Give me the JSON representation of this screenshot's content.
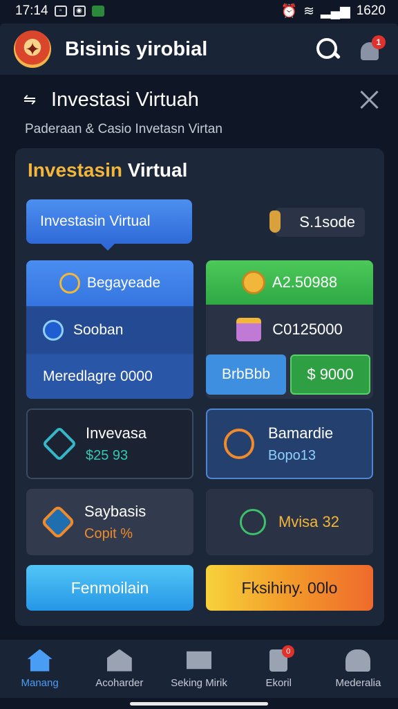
{
  "statusbar": {
    "time": "17:14",
    "right_text": "1620"
  },
  "appbar": {
    "title": "Bisinis yirobial",
    "notification_count": "1"
  },
  "section": {
    "title": "Investasi Virtuah",
    "subtitle": "Paderaan & Casio Invetasn Virtan"
  },
  "card": {
    "title_gold": "Investasin",
    "title_white": " Virtual",
    "tooltip": "Investasin Virtual",
    "balance": "S.1sode",
    "left_panel": {
      "row1": "Begayeade",
      "row2": "Sooban",
      "row3": "Meredlagre 0000"
    },
    "right_panel": {
      "row1": "A2.50988",
      "row2": "C0125000",
      "btn1": "BrbBbb",
      "btn2": "$ 9000"
    },
    "tiles": [
      {
        "name": "Invevasa",
        "value": "$25 93"
      },
      {
        "name": "Bamardie",
        "value": "Bopo13"
      },
      {
        "name": "Saybasis",
        "value": "Copit %"
      },
      {
        "name": "Mvisa 32",
        "value": ""
      }
    ],
    "cta_left": "Fenmoilain",
    "cta_right": "Fksihiny. 00lo"
  },
  "nav": [
    {
      "label": "Manang",
      "icon": "home-icon",
      "active": true
    },
    {
      "label": "Acoharder",
      "icon": "store-icon"
    },
    {
      "label": "Seking Mirik",
      "icon": "mail-icon"
    },
    {
      "label": "Ekoril",
      "icon": "phone-icon",
      "badge": "0"
    },
    {
      "label": "Mederalia",
      "icon": "user-icon"
    }
  ],
  "colors": {
    "accent_blue": "#4a9df5",
    "gold": "#f2b63a",
    "green": "#2ea944",
    "background": "#0f1726"
  }
}
